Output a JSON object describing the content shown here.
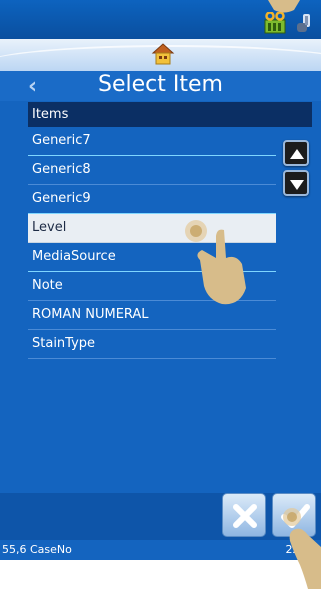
{
  "header": {
    "title": "Select Item",
    "back_icon": "chevron-left-icon",
    "home_icon": "home-icon",
    "status_icons": [
      "ribbon-cartridge-icon",
      "hand-tool-icon"
    ]
  },
  "list": {
    "header": "Items",
    "items": [
      {
        "label": "Generic7"
      },
      {
        "label": "Generic8"
      },
      {
        "label": "Generic9"
      },
      {
        "label": "Level",
        "selected": true
      },
      {
        "label": "MediaSource"
      },
      {
        "label": "Note"
      },
      {
        "label": "ROMAN NUMERAL"
      },
      {
        "label": "StainType"
      }
    ]
  },
  "buttons": {
    "cancel_icon": "close-icon",
    "confirm_icon": "check-icon"
  },
  "footer": {
    "left": "55,6 CaseNo",
    "right": "22 54"
  },
  "colors": {
    "background": "#1464bf",
    "header_row": "#0b2f64",
    "selected_row": "#e9eef3"
  }
}
